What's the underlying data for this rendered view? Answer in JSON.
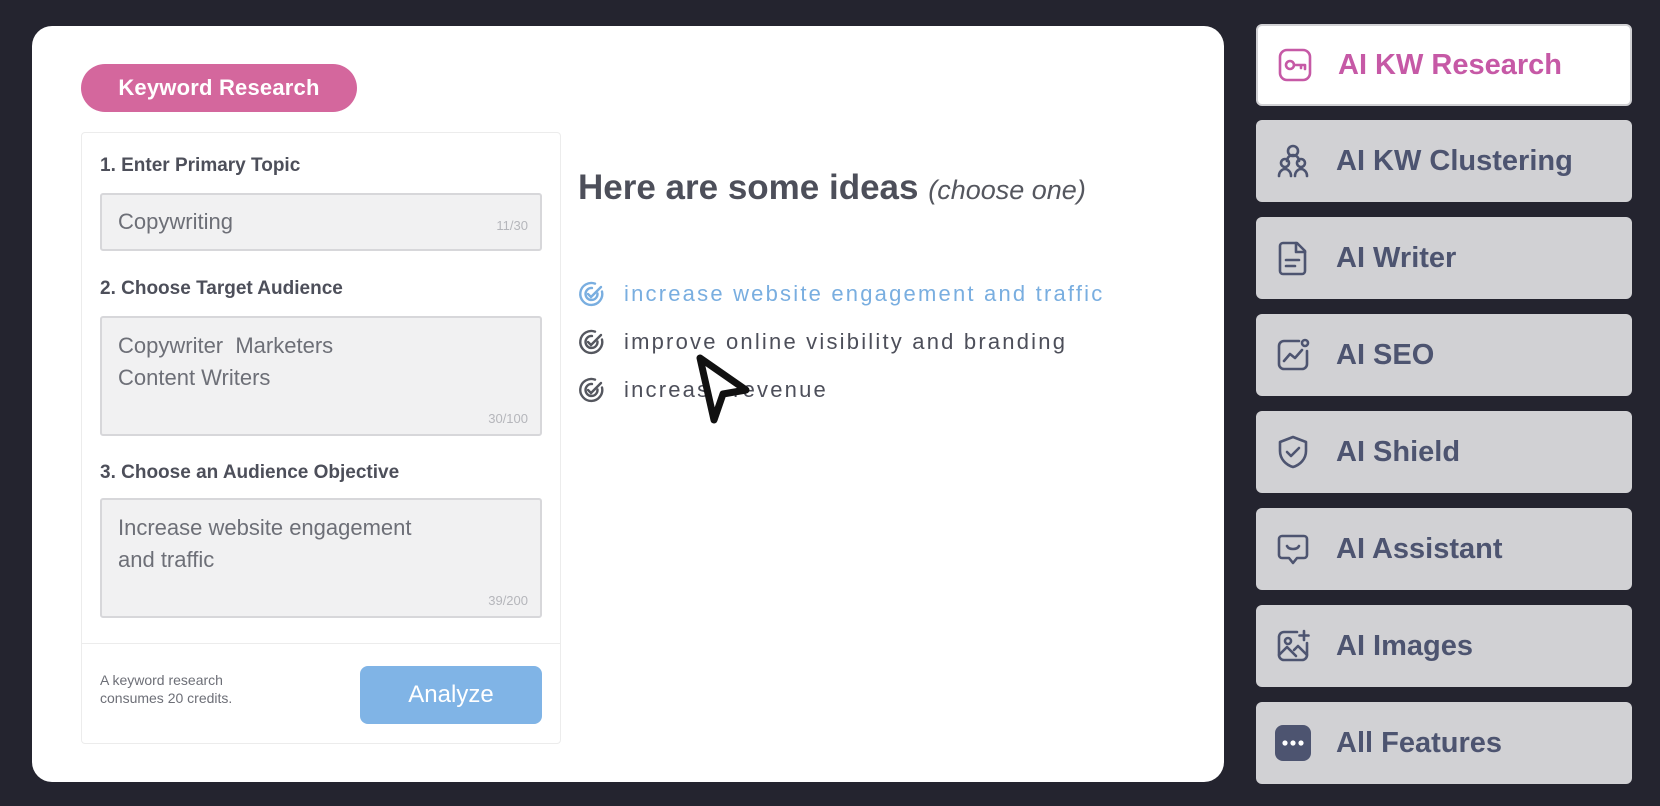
{
  "main": {
    "pill_label": "Keyword Research",
    "form": {
      "step1": {
        "label": "1. Enter Primary Topic",
        "value": "Copywriting",
        "counter": "11/30"
      },
      "step2": {
        "label": "2. Choose Target Audience",
        "line1": "Copywriter  Marketers",
        "line2": "Content Writers",
        "counter": "30/100"
      },
      "step3": {
        "label": "3. Choose an Audience Objective",
        "line1": "Increase website engagement",
        "line2": "and traffic",
        "counter": "39/200"
      },
      "credits_line1": "A keyword research",
      "credits_line2": "consumes 20 credits.",
      "analyze_label": "Analyze"
    },
    "ideas": {
      "title": "Here are some ideas",
      "hint": "(choose one)",
      "items": [
        {
          "text": "increase website engagement and traffic",
          "state": "highlighted"
        },
        {
          "text": "improve online visibility and branding",
          "state": "normal"
        },
        {
          "text": "increase revenue",
          "state": "normal"
        }
      ]
    }
  },
  "features": [
    {
      "label": "AI KW Research",
      "icon": "key-icon",
      "active": true
    },
    {
      "label": "AI KW Clustering",
      "icon": "people-cluster-icon",
      "active": false
    },
    {
      "label": "AI Writer",
      "icon": "document-icon",
      "active": false
    },
    {
      "label": "AI SEO",
      "icon": "chart-icon",
      "active": false
    },
    {
      "label": "AI Shield",
      "icon": "shield-icon",
      "active": false
    },
    {
      "label": "AI Assistant",
      "icon": "chat-smile-icon",
      "active": false
    },
    {
      "label": "AI Images",
      "icon": "image-add-icon",
      "active": false
    },
    {
      "label": "All Features",
      "icon": "more-dots-icon",
      "active": false
    }
  ],
  "colors": {
    "background": "#24242f",
    "pill": "#d4679d",
    "analyze_button": "#80b4e6",
    "active_feature_text": "#c659a6",
    "feature_text": "#4d5470",
    "highlight_idea": "#79aee0"
  }
}
